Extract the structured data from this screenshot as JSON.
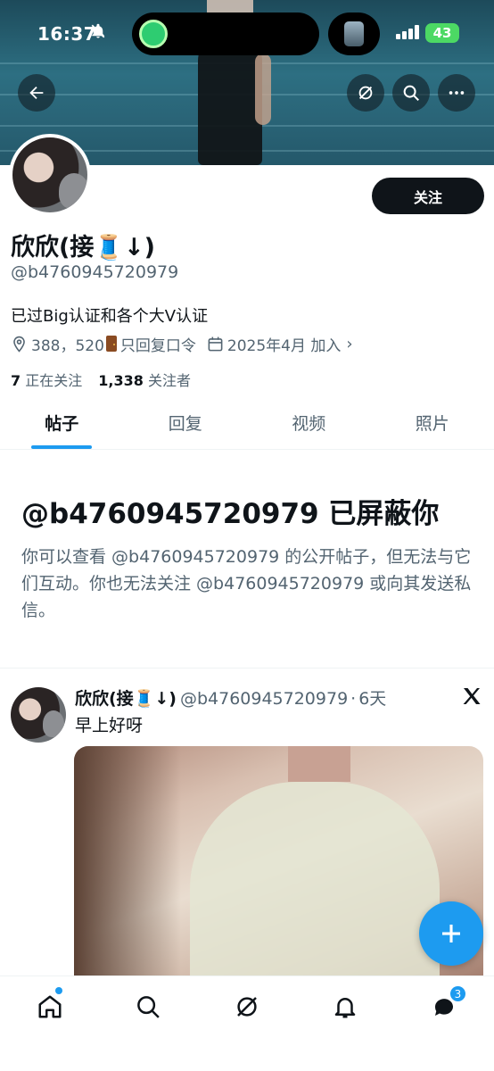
{
  "status_bar": {
    "time": "16:37",
    "battery": "43"
  },
  "profile": {
    "display_name": "欣欣(接🧵↓)",
    "handle": "@b4760945720979",
    "bio": "已过Big认证和各个大V认证",
    "location_text": "388，520",
    "location_suffix": "只回复口令",
    "joined": "2025年4月 加入",
    "following_count": "7",
    "following_label": "正在关注",
    "followers_count": "1,338",
    "followers_label": "关注者",
    "follow_button": "关注"
  },
  "tabs": [
    {
      "label": "帖子",
      "active": true
    },
    {
      "label": "回复",
      "active": false
    },
    {
      "label": "视频",
      "active": false
    },
    {
      "label": "照片",
      "active": false
    }
  ],
  "blocked": {
    "title": "@b4760945720979 已屏蔽你",
    "description": "你可以查看 @b4760945720979 的公开帖子，但无法与它们互动。你也无法关注 @b4760945720979 或向其发送私信。"
  },
  "post": {
    "author_name": "欣欣(接🧵↓)",
    "author_handle": "@b4760945720979",
    "separator": "·",
    "time": "6天",
    "text": "早上好呀"
  },
  "bottom_nav": {
    "items": [
      "home-icon",
      "search-icon",
      "grok-icon",
      "notifications-icon",
      "messages-icon"
    ],
    "messages_badge": "3"
  },
  "colors": {
    "accent": "#1d9bf0",
    "text_primary": "#0f1419",
    "text_secondary": "#536471"
  }
}
